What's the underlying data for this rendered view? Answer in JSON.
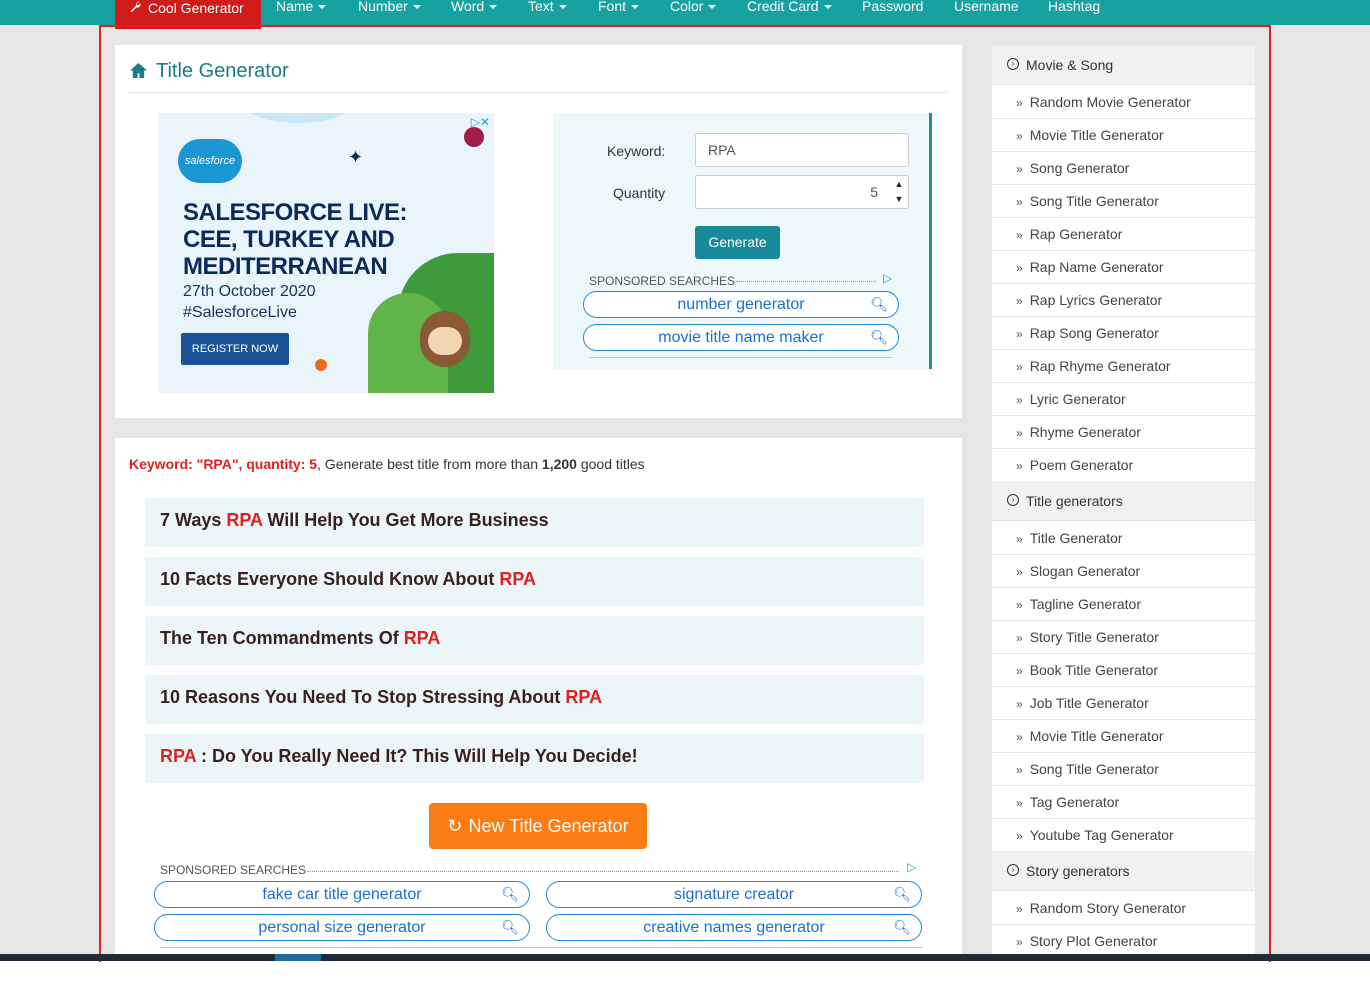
{
  "nav": {
    "brand": "Cool Generator",
    "items": [
      {
        "label": "Name",
        "dropdown": true
      },
      {
        "label": "Number",
        "dropdown": true
      },
      {
        "label": "Word",
        "dropdown": true
      },
      {
        "label": "Text",
        "dropdown": true
      },
      {
        "label": "Font",
        "dropdown": true
      },
      {
        "label": "Color",
        "dropdown": true
      },
      {
        "label": "Credit Card",
        "dropdown": true
      },
      {
        "label": "Password",
        "dropdown": false
      },
      {
        "label": "Username",
        "dropdown": false
      },
      {
        "label": "Hashtag",
        "dropdown": false
      }
    ]
  },
  "colors": {
    "nav_bg": "#17a2a2",
    "brand_bg": "#d01b1b",
    "accent_teal": "#178a9b",
    "keyword_red": "#e01f1f",
    "button_orange": "#fb7c12"
  },
  "page": {
    "title": "Title Generator",
    "icon": "home-icon"
  },
  "ad": {
    "logo": "salesforce",
    "headline": "SALESFORCE LIVE: CEE, TURKEY AND MEDITERRANEAN",
    "date": "27th October 2020",
    "hashtag": "#SalesforceLive",
    "cta": "REGISTER NOW",
    "adchoices": "▷✕"
  },
  "form": {
    "keyword_label": "Keyword:",
    "keyword_value": "RPA",
    "quantity_label": "Quantity",
    "quantity_value": "5",
    "generate_label": "Generate"
  },
  "sponsored_top": {
    "label": "SPONSORED SEARCHES",
    "items": [
      "number generator",
      "movie title name maker"
    ]
  },
  "results": {
    "summary_prefix": "Keyword: \"RPA\", quantity: 5",
    "summary_mid": ", Generate best title from more than ",
    "summary_count": "1,200",
    "summary_suffix": " good titles",
    "keyword": "RPA",
    "titles": [
      {
        "before": "7 Ways ",
        "after": " Will Help You Get More Business"
      },
      {
        "before": "10 Facts Everyone Should Know About ",
        "after": ""
      },
      {
        "before": "The Ten Commandments Of ",
        "after": ""
      },
      {
        "before": "10 Reasons You Need To Stop Stressing About ",
        "after": ""
      },
      {
        "before": "",
        "after": " : Do You Really Need It? This Will Help You Decide!"
      }
    ],
    "new_button": "New Title Generator"
  },
  "sponsored_bottom": {
    "label": "SPONSORED SEARCHES",
    "items": [
      "fake car title generator",
      "signature creator",
      "personal size generator",
      "creative names generator"
    ]
  },
  "sidebar": {
    "sections": [
      {
        "heading": "Movie & Song",
        "items": [
          "Random Movie Generator",
          "Movie Title Generator",
          "Song Generator",
          "Song Title Generator",
          "Rap Generator",
          "Rap Name Generator",
          "Rap Lyrics Generator",
          "Rap Song Generator",
          "Rap Rhyme Generator",
          "Lyric Generator",
          "Rhyme Generator",
          "Poem Generator"
        ]
      },
      {
        "heading": "Title generators",
        "items": [
          "Title Generator",
          "Slogan Generator",
          "Tagline Generator",
          "Story Title Generator",
          "Book Title Generator",
          "Job Title Generator",
          "Movie Title Generator",
          "Song Title Generator",
          "Tag Generator",
          "Youtube Tag Generator"
        ]
      },
      {
        "heading": "Story generators",
        "items": [
          "Random Story Generator",
          "Story Plot Generator"
        ]
      }
    ]
  }
}
